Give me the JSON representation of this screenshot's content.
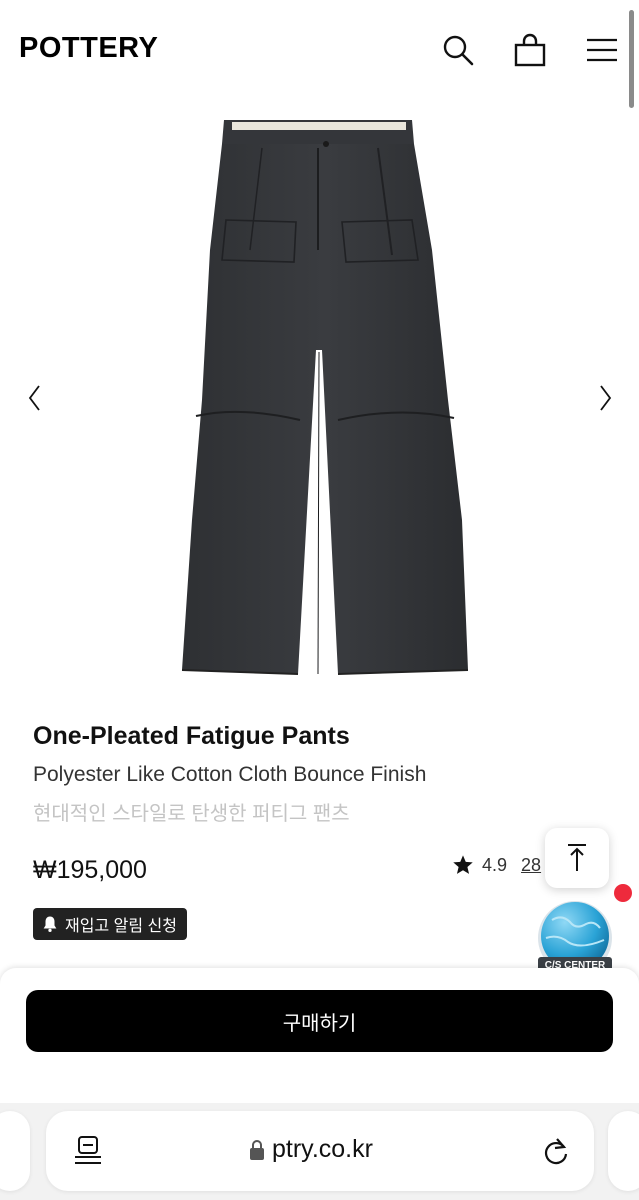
{
  "header": {
    "logo": "POTTERY",
    "icons": [
      "search-icon",
      "shopping-bag-icon",
      "menu-icon"
    ]
  },
  "gallery": {
    "image_alt": "charcoal one-pleated fatigue pants product photo",
    "prev": "‹",
    "next": "›"
  },
  "product": {
    "name": "One-Pleated Fatigue Pants",
    "subname": "Polyester Like Cotton Cloth Bounce Finish",
    "description": "현대적인 스타일로 탄생한 퍼티그 팬츠",
    "price": "₩195,000",
    "rating": "4.9",
    "review_count": "28",
    "restock_label": "재입고 알림 신청"
  },
  "floating": {
    "cs_label": "C/S CENTER"
  },
  "buy": {
    "label": "구매하기"
  },
  "browser": {
    "url": "ptry.co.kr"
  },
  "colors": {
    "primary": "#000000",
    "badge_dot": "#ee2a3c",
    "cs_globe": "#2aa3d6"
  }
}
